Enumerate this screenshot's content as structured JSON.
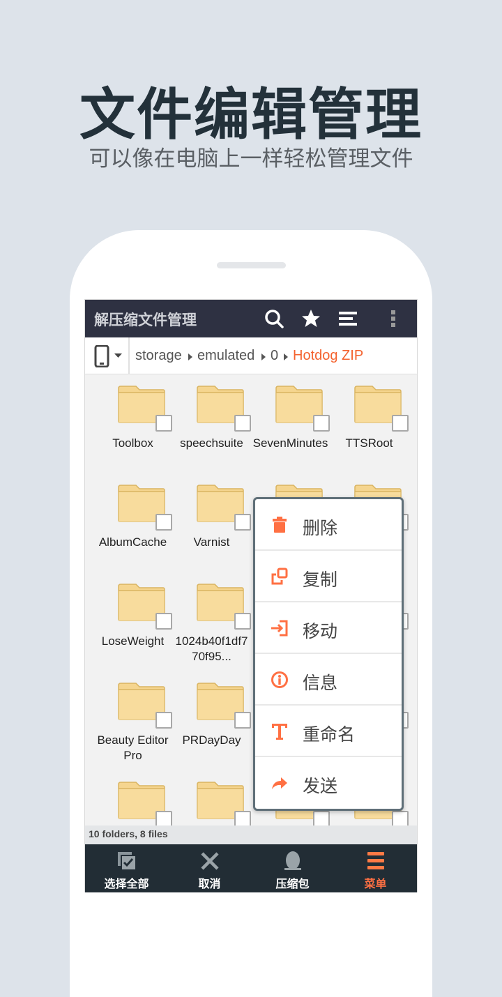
{
  "hero": {
    "title": "文件编辑管理",
    "subtitle": "可以像在电脑上一样轻松管理文件"
  },
  "app": {
    "title": "解压缩文件管理",
    "accent": "#ff7043",
    "toolbar_icons": [
      "search-icon",
      "star-icon",
      "list-icon",
      "more-vert-icon"
    ]
  },
  "breadcrumb": {
    "items": [
      "storage",
      "emulated",
      "0"
    ],
    "current": "Hotdog ZIP"
  },
  "files": [
    {
      "name": "Toolbox"
    },
    {
      "name": "speechsuite"
    },
    {
      "name": "SevenMinutes"
    },
    {
      "name": "TTSRoot"
    },
    {
      "name": "AlbumCache"
    },
    {
      "name": "Varnist"
    },
    {},
    {},
    {
      "name": "LoseWeight"
    },
    {
      "name": "1024b40f1df770f95..."
    },
    {},
    {},
    {
      "name": "Beauty Editor Pro"
    },
    {
      "name": "PRDayDay"
    },
    {},
    {},
    {},
    {},
    {},
    {}
  ],
  "status": "10 folders, 8 files",
  "bottom_bar": [
    {
      "label": "选择全部",
      "icon": "select-all-icon"
    },
    {
      "label": "取消",
      "icon": "close-icon"
    },
    {
      "label": "压缩包",
      "icon": "archive-icon"
    },
    {
      "label": "菜单",
      "icon": "menu-icon",
      "active": true
    }
  ],
  "context_menu": [
    {
      "label": "删除",
      "icon": "trash-icon"
    },
    {
      "label": "复制",
      "icon": "copy-icon"
    },
    {
      "label": "移动",
      "icon": "move-icon"
    },
    {
      "label": "信息",
      "icon": "info-icon"
    },
    {
      "label": "重命名",
      "icon": "rename-icon"
    },
    {
      "label": "发送",
      "icon": "share-icon"
    }
  ]
}
